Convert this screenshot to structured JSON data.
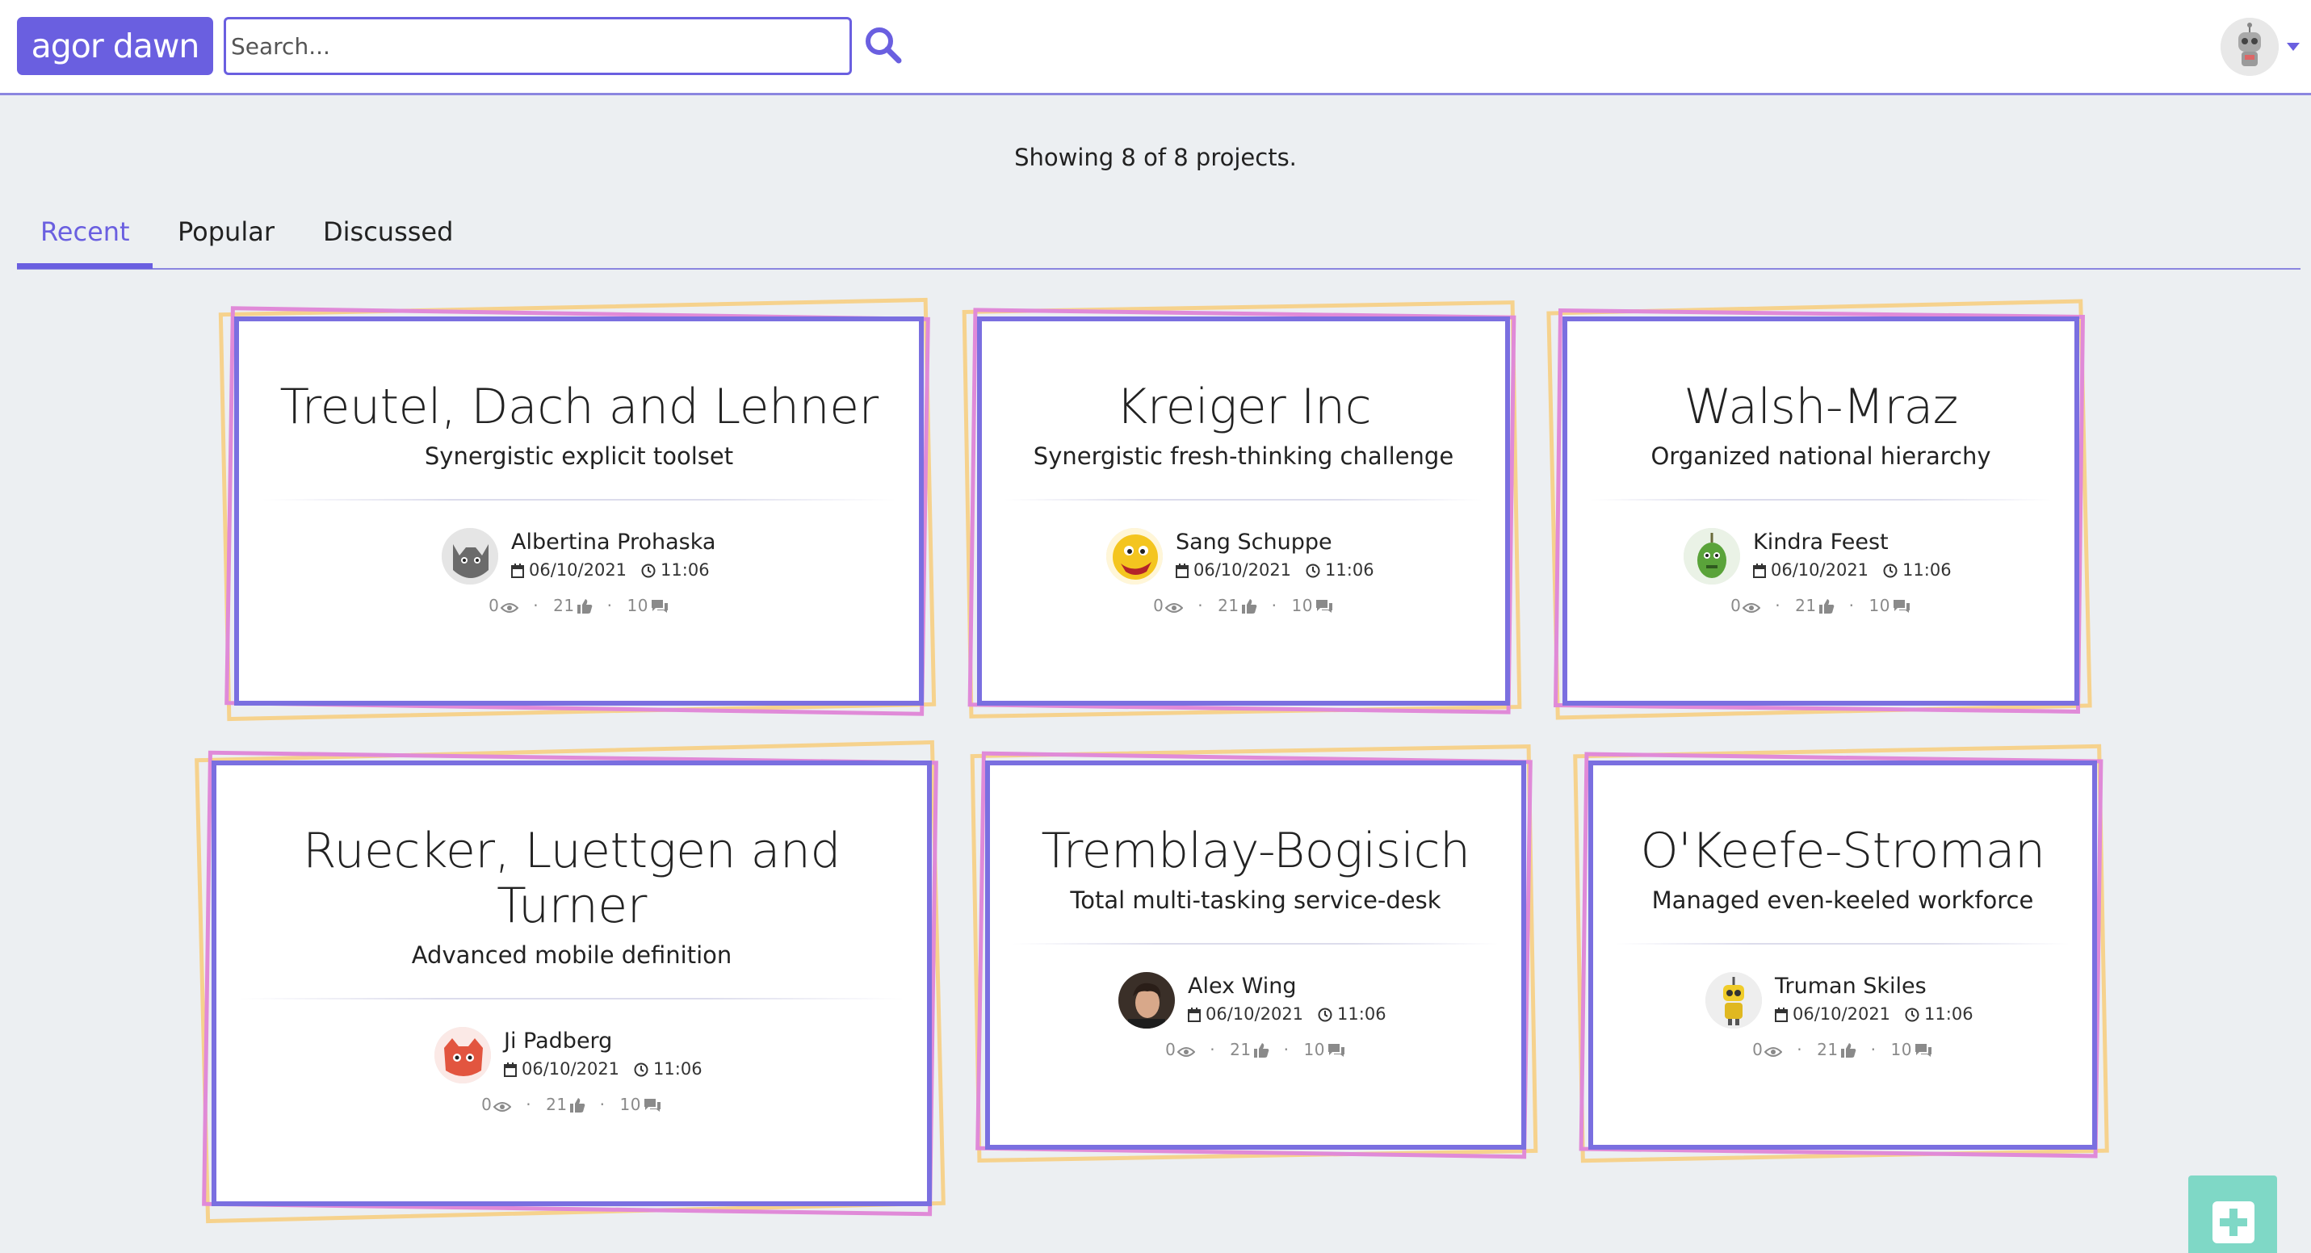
{
  "header": {
    "logo_text": "agor dawn",
    "search_placeholder": "Search...",
    "search_icon": "search-icon",
    "user_icon": "robot-avatar",
    "accent_color": "#6a5fe0"
  },
  "status": {
    "showing_text": "Showing 8 of 8 projects."
  },
  "tabs": [
    {
      "label": "Recent",
      "active": true
    },
    {
      "label": "Popular",
      "active": false
    },
    {
      "label": "Discussed",
      "active": false
    }
  ],
  "projects": [
    {
      "title": "Treutel, Dach and Lehner",
      "subtitle": "Synergistic explicit toolset",
      "author": "Albertina Prohaska",
      "date": "06/10/2021",
      "time": "11:06",
      "views": "0",
      "likes": "21",
      "comments": "10",
      "avatar_icon": "cat-avatar-icon"
    },
    {
      "title": "Kreiger Inc",
      "subtitle": "Synergistic fresh-thinking challenge",
      "author": "Sang Schuppe",
      "date": "06/10/2021",
      "time": "11:06",
      "views": "0",
      "likes": "21",
      "comments": "10",
      "avatar_icon": "yellow-monster-avatar-icon"
    },
    {
      "title": "Walsh-Mraz",
      "subtitle": "Organized national hierarchy",
      "author": "Kindra Feest",
      "date": "06/10/2021",
      "time": "11:06",
      "views": "0",
      "likes": "21",
      "comments": "10",
      "avatar_icon": "green-monster-avatar-icon"
    },
    {
      "title": "Ruecker, Luettgen and Turner",
      "subtitle": "Advanced mobile definition",
      "author": "Ji Padberg",
      "date": "06/10/2021",
      "time": "11:06",
      "views": "0",
      "likes": "21",
      "comments": "10",
      "avatar_icon": "red-monster-avatar-icon"
    },
    {
      "title": "Tremblay-Bogisich",
      "subtitle": "Total multi-tasking service-desk",
      "author": "Alex Wing",
      "date": "06/10/2021",
      "time": "11:06",
      "views": "0",
      "likes": "21",
      "comments": "10",
      "avatar_icon": "person-photo-avatar-icon"
    },
    {
      "title": "O'Keefe-Stroman",
      "subtitle": "Managed even-keeled workforce",
      "author": "Truman Skiles",
      "date": "06/10/2021",
      "time": "11:06",
      "views": "0",
      "likes": "21",
      "comments": "10",
      "avatar_icon": "yellow-robot-avatar-icon"
    }
  ],
  "fab": {
    "icon": "plus-square-icon"
  }
}
